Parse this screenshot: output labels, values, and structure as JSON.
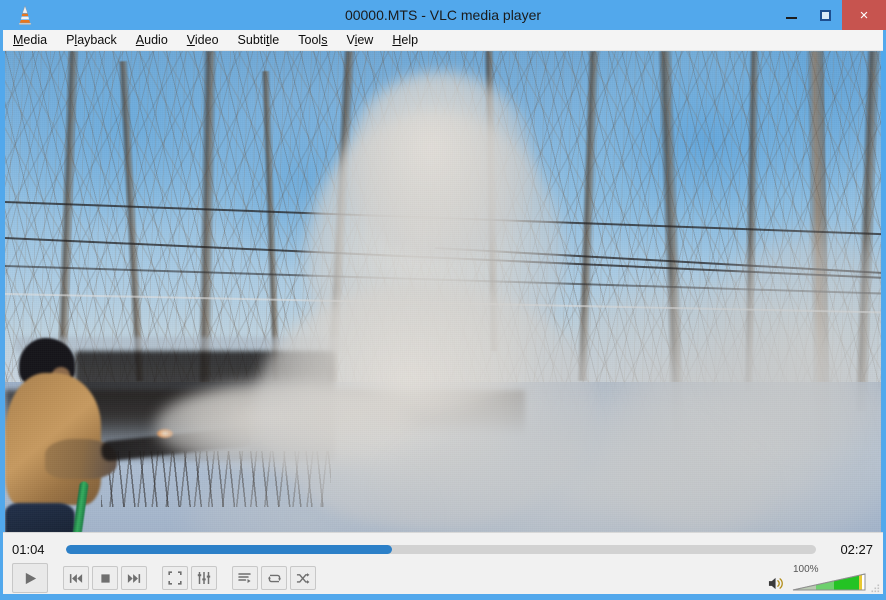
{
  "window": {
    "title": "00000.MTS - VLC media player",
    "app_icon": "vlc-cone-icon",
    "frame_color": "#52a8ec",
    "controls": {
      "minimize_label": "–",
      "maximize_label": "□",
      "close_label": "×"
    }
  },
  "menubar": {
    "items": [
      {
        "label": "Media",
        "mnemonic_index": 0
      },
      {
        "label": "Playback",
        "mnemonic_index": 1
      },
      {
        "label": "Audio",
        "mnemonic_index": 0
      },
      {
        "label": "Video",
        "mnemonic_index": 0
      },
      {
        "label": "Subtitle",
        "mnemonic_index": 5
      },
      {
        "label": "Tools",
        "mnemonic_index": 4
      },
      {
        "label": "View",
        "mnemonic_index": 1
      },
      {
        "label": "Help",
        "mnemonic_index": 0
      }
    ]
  },
  "video": {
    "description": "Snowy winter backyard scene: person in tan coat and black hat spraying a large white steam plume toward bare trees under a blue sky with power lines",
    "state": "playing"
  },
  "transport": {
    "elapsed": "01:04",
    "total": "02:27",
    "progress_percent": 43.5,
    "seek_fill_color": "#2c80c8",
    "seek_track_color": "#d2d2d2",
    "buttons": [
      {
        "name": "play-button",
        "icon": "play-icon"
      },
      {
        "name": "previous-button",
        "icon": "skip-backward-icon"
      },
      {
        "name": "stop-button",
        "icon": "stop-icon"
      },
      {
        "name": "next-button",
        "icon": "skip-forward-icon"
      },
      {
        "name": "fullscreen-button",
        "icon": "fullscreen-icon"
      },
      {
        "name": "effects-button",
        "icon": "equalizer-icon"
      },
      {
        "name": "playlist-button",
        "icon": "playlist-icon"
      },
      {
        "name": "loop-button",
        "icon": "loop-icon"
      },
      {
        "name": "random-button",
        "icon": "shuffle-icon"
      }
    ]
  },
  "volume": {
    "level_label": "100%",
    "level_percent": 100,
    "mute_icon": "speaker-icon",
    "fill_color": "#3fc23f",
    "marker_color": "#e8c832"
  }
}
